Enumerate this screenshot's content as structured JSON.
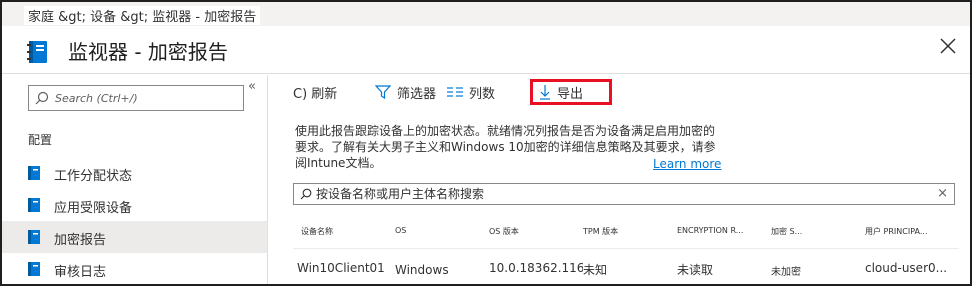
{
  "breadcrumb": "家庭 &gt;  设备 &gt;    监视器 - 加密报告",
  "page_title": "监视器 - 加密报告",
  "sidebar": {
    "collapse_label": "«",
    "search_placeholder": "Search (Ctrl+/)",
    "section_label": "配置",
    "items": [
      {
        "label": "工作分配状态",
        "icon": "blade-icon",
        "selected": false
      },
      {
        "label": "应用受限设备",
        "icon": "blade-icon",
        "selected": false
      },
      {
        "label": "加密报告",
        "icon": "blade-icon",
        "selected": true
      },
      {
        "label": "审核日志",
        "icon": "blade-icon",
        "selected": false
      }
    ]
  },
  "toolbar": {
    "refresh_label": "C) 刷新",
    "filter_label": "筛选器",
    "columns_label": "列数",
    "export_label": "导出"
  },
  "description": "使用此报告跟踪设备上的加密状态。就绪情况列报告是否为设备满足启用加密的要求。了解有关大男子主义和Windows 10加密的详细信息策略及其要求，请参阅Intune文档。",
  "learn_more": "Learn more",
  "table": {
    "search_placeholder": "按设备名称或用户主体名称搜索",
    "clear_label": "×",
    "columns": [
      "设备名称",
      "OS",
      "OS 版本",
      "TPM 版本",
      "ENCRYPTION R...",
      "加密 S...",
      "用户 PRINCIPA..."
    ],
    "rows": [
      [
        "Win10Client01",
        "Windows",
        "10.0.18362.116",
        "未知",
        "未读取",
        "未加密",
        "cloud-user0..."
      ]
    ]
  },
  "colors": {
    "highlight": "#e81123",
    "link": "#0078d4",
    "icon_blue": "#0078d4"
  }
}
